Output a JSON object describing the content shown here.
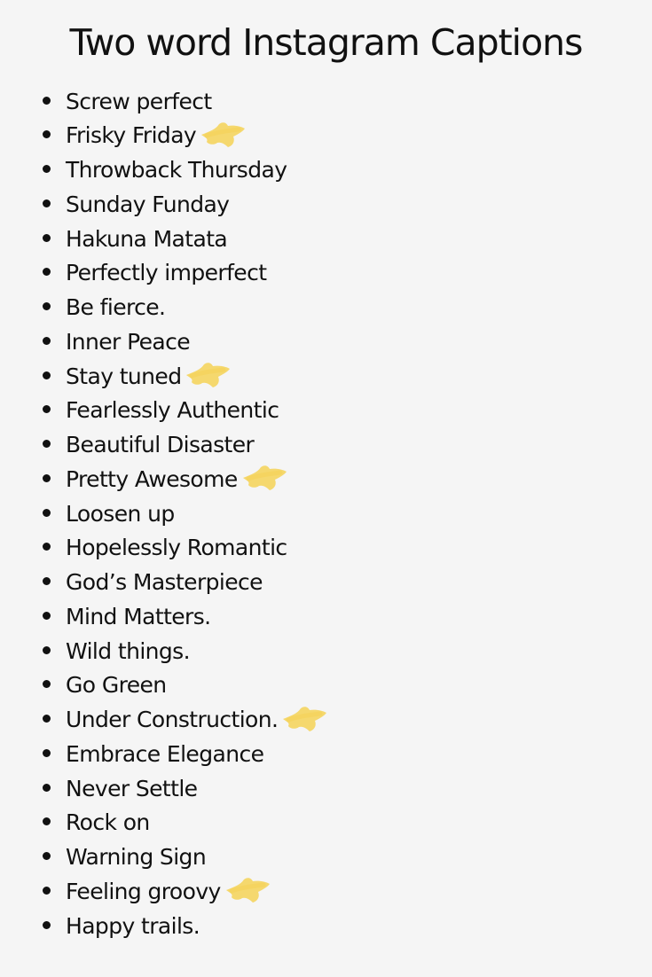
{
  "title": "Two word Instagram Captions",
  "highlight_color": "#f5d256",
  "captions": [
    {
      "text": "Screw perfect",
      "starred": false
    },
    {
      "text": "Frisky Friday",
      "starred": true
    },
    {
      "text": "Throwback Thursday",
      "starred": false
    },
    {
      "text": "Sunday Funday",
      "starred": false
    },
    {
      "text": "Hakuna Matata",
      "starred": false
    },
    {
      "text": "Perfectly imperfect",
      "starred": false
    },
    {
      "text": "Be fierce.",
      "starred": false
    },
    {
      "text": "Inner Peace",
      "starred": false
    },
    {
      "text": "Stay tuned",
      "starred": true
    },
    {
      "text": "Fearlessly Authentic",
      "starred": false
    },
    {
      "text": "Beautiful Disaster",
      "starred": false
    },
    {
      "text": "Pretty Awesome",
      "starred": true
    },
    {
      "text": "Loosen up",
      "starred": false
    },
    {
      "text": "Hopelessly Romantic",
      "starred": false
    },
    {
      "text": "God’s Masterpiece",
      "starred": false
    },
    {
      "text": "Mind Matters.",
      "starred": false
    },
    {
      "text": "Wild things.",
      "starred": false
    },
    {
      "text": "Go Green",
      "starred": false
    },
    {
      "text": "Under Construction.",
      "starred": true
    },
    {
      "text": "Embrace Elegance",
      "starred": false
    },
    {
      "text": "Never Settle",
      "starred": false
    },
    {
      "text": "Rock on",
      "starred": false
    },
    {
      "text": "Warning Sign",
      "starred": false
    },
    {
      "text": "Feeling groovy",
      "starred": true
    },
    {
      "text": "Happy trails.",
      "starred": false
    }
  ]
}
